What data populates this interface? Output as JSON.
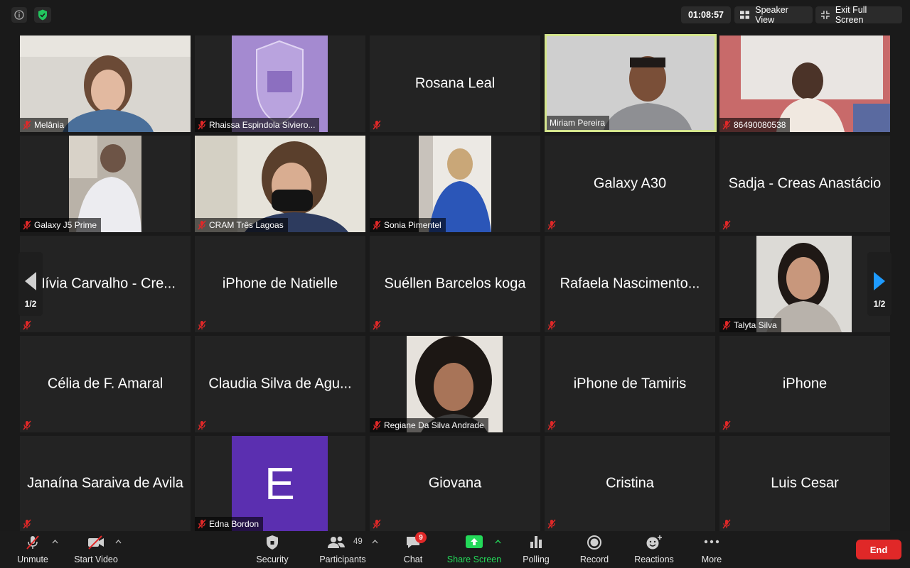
{
  "header": {
    "timer": "01:08:57",
    "speaker_view": "Speaker View",
    "exit_full_screen": "Exit Full Screen"
  },
  "pager": {
    "page": "1/2"
  },
  "tiles": [
    {
      "name": "Melânia"
    },
    {
      "name": "Rhaissa Espindola Siviero..."
    },
    {
      "name": "Rosana Leal"
    },
    {
      "name": "Miriam Pereira"
    },
    {
      "name": "86490080538"
    },
    {
      "name": "Galaxy J5 Prime"
    },
    {
      "name": "CRAM Três Lagoas"
    },
    {
      "name": "Sonia Pimentel"
    },
    {
      "name": "Galaxy A30"
    },
    {
      "name": "Sadja - Creas Anastácio"
    },
    {
      "name": "Nívia Carvalho - Cre..."
    },
    {
      "name": "iPhone de Natielle"
    },
    {
      "name": "Suéllen Barcelos koga"
    },
    {
      "name": "Rafaela Nascimento..."
    },
    {
      "name": "Talyta Silva"
    },
    {
      "name": "Célia de F. Amaral"
    },
    {
      "name": "Claudia Silva de Agu..."
    },
    {
      "name": "Regiane Da Silva Andrade"
    },
    {
      "name": "iPhone de Tamiris"
    },
    {
      "name": "iPhone"
    },
    {
      "name": "Janaína Saraiva de Avila"
    },
    {
      "name": "Edna Bordon",
      "initial": "E"
    },
    {
      "name": "Giovana"
    },
    {
      "name": "Cristina"
    },
    {
      "name": "Luis Cesar"
    }
  ],
  "toolbar": {
    "unmute": "Unmute",
    "start_video": "Start Video",
    "security": "Security",
    "participants": "Participants",
    "participants_count": "49",
    "chat": "Chat",
    "chat_badge": "9",
    "share_screen": "Share Screen",
    "polling": "Polling",
    "record": "Record",
    "reactions": "Reactions",
    "more": "More",
    "end": "End"
  },
  "colors": {
    "active_speaker_border": "#d5e68e",
    "share_green": "#23d959",
    "end_red": "#e02828",
    "muted_red": "#e02828",
    "tile_bg": "#232323"
  }
}
